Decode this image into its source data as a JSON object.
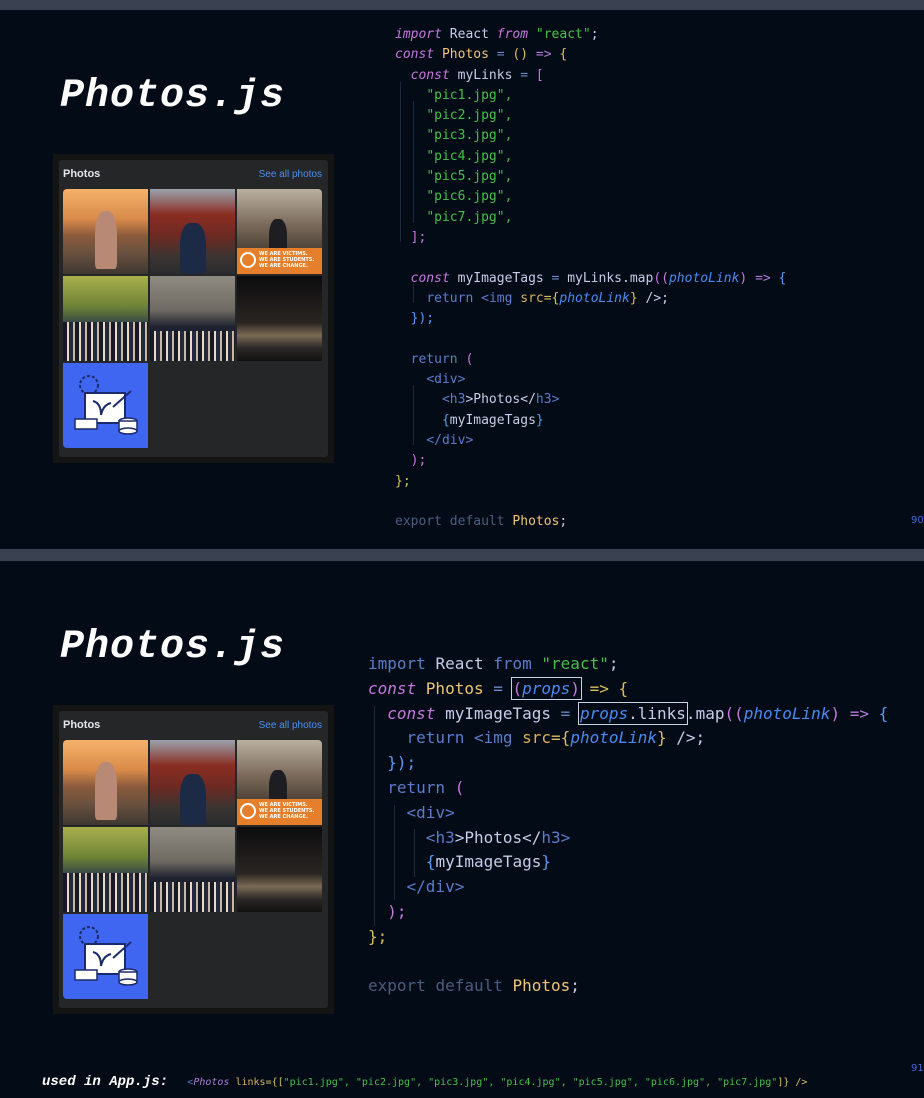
{
  "slides": [
    {
      "title": "Photos.js",
      "card": {
        "header": "Photos",
        "link": "See all photos"
      },
      "banner": {
        "lines": [
          "WE ARE VICTIMS.",
          "WE ARE STUDENTS.",
          "WE ARE CHANGE."
        ]
      },
      "code": {
        "l1": {
          "a": "import ",
          "b": "React",
          "c": " from ",
          "d": "\"react\"",
          "e": ";"
        },
        "l2": {
          "a": "const ",
          "b": "Photos",
          "c": " = ",
          "d": "() ",
          "e": "=>",
          "f": " {"
        },
        "l3": {
          "a": "const ",
          "b": "myLinks",
          "c": " = ",
          "d": "["
        },
        "links": [
          "\"pic1.jpg\",",
          "\"pic2.jpg\",",
          "\"pic3.jpg\",",
          "\"pic4.jpg\",",
          "\"pic5.jpg\",",
          "\"pic6.jpg\",",
          "\"pic7.jpg\","
        ],
        "l11": {
          "a": "];"
        },
        "l13": {
          "a": "const ",
          "b": "myImageTags",
          "c": " = ",
          "d": "myLinks",
          "e": ".",
          "f": "map",
          "g": "((",
          "h": "photoLink",
          "i": ") ",
          "j": "=>",
          "k": " {"
        },
        "l14": {
          "a": "return ",
          "b": "<",
          "c": "img ",
          "d": "src",
          "e": "={",
          "f": "photoLink",
          "g": "} ",
          "h": "/>;"
        },
        "l15": {
          "a": "});"
        },
        "l17": {
          "a": "return ",
          "b": "("
        },
        "l18": {
          "a": "<",
          "b": "div",
          "c": ">"
        },
        "l19": {
          "a": "<",
          "b": "h3",
          "c": ">Photos</",
          "d": "h3",
          "e": ">"
        },
        "l20": {
          "a": "{",
          "b": "myImageTags",
          "c": "}"
        },
        "l21": {
          "a": "</",
          "b": "div",
          "c": ">"
        },
        "l22": {
          "a": ");"
        },
        "l23": {
          "a": "};"
        },
        "l25": {
          "a": "export ",
          "b": "default ",
          "c": "Photos",
          "d": ";"
        }
      },
      "page_number": "90"
    },
    {
      "title": "Photos.js",
      "card": {
        "header": "Photos",
        "link": "See all photos"
      },
      "banner": {
        "lines": [
          "WE ARE VICTIMS.",
          "WE ARE STUDENTS.",
          "WE ARE CHANGE."
        ]
      },
      "code": {
        "l1": {
          "a": "import ",
          "b": "React",
          "c": " from ",
          "d": "\"react\"",
          "e": ";"
        },
        "l2": {
          "a": "const ",
          "b": "Photos",
          "c": " = ",
          "d": "(",
          "e": "props",
          "f": ")",
          "g": " => {"
        },
        "l3": {
          "a": "const ",
          "b": "myImageTags",
          "c": " = ",
          "d": "props",
          "e": ".",
          "f": "links",
          "g": ".",
          "h": "map",
          "i": "((",
          "j": "photoLink",
          "k": ") ",
          "l": "=>",
          "m": " {"
        },
        "l4": {
          "a": "return ",
          "b": "<",
          "c": "img ",
          "d": "src",
          "e": "={",
          "f": "photoLink",
          "g": "} ",
          "h": "/>;"
        },
        "l5": {
          "a": "});"
        },
        "l6": {
          "a": "return ",
          "b": "("
        },
        "l7": {
          "a": "<",
          "b": "div",
          "c": ">"
        },
        "l8": {
          "a": "<",
          "b": "h3",
          "c": ">Photos</",
          "d": "h3",
          "e": ">"
        },
        "l9": {
          "a": "{",
          "b": "myImageTags",
          "c": "}"
        },
        "l10": {
          "a": "</",
          "b": "div",
          "c": ">"
        },
        "l11": {
          "a": ");"
        },
        "l12": {
          "a": "};"
        },
        "l14": {
          "a": "export ",
          "b": "default ",
          "c": "Photos",
          "d": ";"
        }
      },
      "page_number": "91"
    }
  ],
  "footer": {
    "label": "used in App.js:",
    "tag_open": "<",
    "tag_name": "Photos",
    "attr": " links",
    "eq": "={[",
    "values": "\"pic1.jpg\", \"pic2.jpg\", \"pic3.jpg\", \"pic4.jpg\", \"pic5.jpg\", \"pic6.jpg\", \"pic7.jpg\"",
    "close": "]} />"
  },
  "colors": {
    "background": "#030b17",
    "divider": "#3a4150",
    "string": "#46c04a",
    "keyword": "#5b7cc9",
    "param": "#4b8af0",
    "accent_blue": "#3f66f0",
    "banner_orange": "#e57f2b"
  }
}
